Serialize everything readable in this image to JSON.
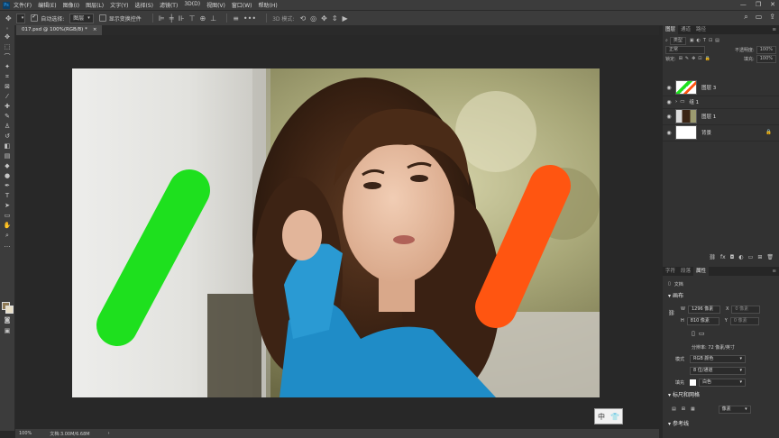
{
  "menubar": {
    "logo": "Ps",
    "items": [
      "文件(F)",
      "编辑(E)",
      "图像(I)",
      "图层(L)",
      "文字(Y)",
      "选择(S)",
      "滤镜(T)",
      "3D(D)",
      "视图(V)",
      "窗口(W)",
      "帮助(H)"
    ],
    "minimize": "—",
    "restore": "❐",
    "close": "✕"
  },
  "options": {
    "auto_select_label": "自动选择:",
    "auto_select_target": "图层",
    "show_transform_label": "显示变换控件",
    "mode_3d_label": "3D 模式:"
  },
  "document": {
    "tab_title": "017.psd @ 100%(RGB/8) *",
    "tab_close": "×"
  },
  "status": {
    "zoom": "100%",
    "doc_size": "文档:3.00M/6.68M"
  },
  "translate_badge": {
    "a": "中",
    "b": "👕"
  },
  "layers_panel": {
    "tabs": [
      "图层",
      "通道",
      "路径"
    ],
    "filter_kind": "类型",
    "blend_mode": "正常",
    "opacity_label": "不透明度:",
    "opacity_value": "100%",
    "lock_label": "锁定:",
    "fill_label": "填充:",
    "fill_value": "100%",
    "layers": [
      {
        "name": "图层 3",
        "selected": false
      },
      {
        "name": "组 1",
        "selected": false
      },
      {
        "name": "图层 1",
        "selected": false
      },
      {
        "name": "背景",
        "selected": false
      }
    ]
  },
  "properties_panel": {
    "tabs": [
      "字符",
      "段落",
      "属性"
    ],
    "doc_label": "文档",
    "canvas_section": "画布",
    "w_label": "W",
    "w_value": "1296 像素",
    "h_label": "H",
    "h_value": "810 像素",
    "x_label": "X",
    "x_value": "0 像素",
    "y_label": "Y",
    "y_value": "0 像素",
    "resolution": "分辨率: 72 像素/英寸",
    "mode_label": "模式",
    "mode_value": "RGB 颜色",
    "depth_value": "8 位/通道",
    "fill_label": "填充",
    "fill_value": "白色",
    "rulers_section": "标尺和网格",
    "rulers_unit": "像素",
    "guides_section": "参考线"
  },
  "colors": {
    "green_stroke": "#1ee01e",
    "orange_stroke": "#ff5511",
    "foreground": "#8f7a55",
    "background": "#e9e0c8"
  }
}
